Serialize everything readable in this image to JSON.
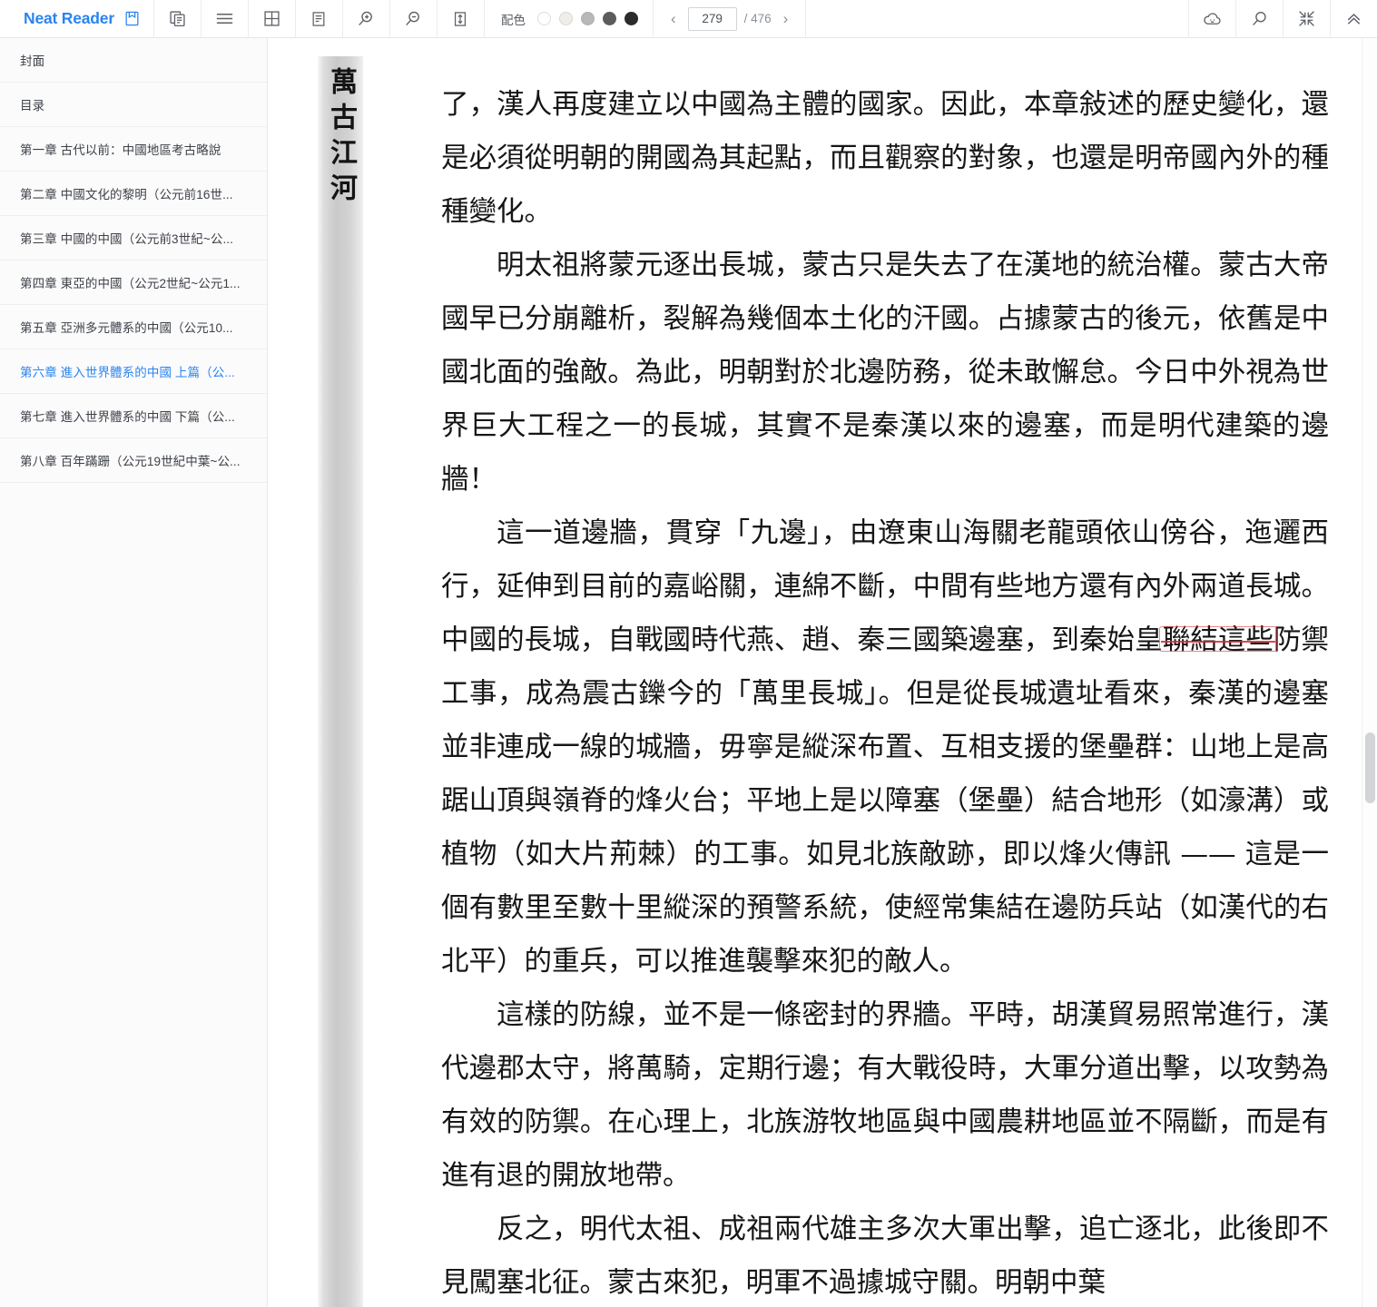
{
  "app": {
    "brand": "Neat Reader",
    "brand_accent": "#2a84f0"
  },
  "toolbar": {
    "icons": [
      {
        "name": "save-to-device-icon",
        "label": "保存"
      },
      {
        "name": "copy-pages-icon",
        "label": "双页"
      },
      {
        "name": "list-view-icon",
        "label": "列表"
      },
      {
        "name": "grid-view-icon",
        "label": "网格"
      },
      {
        "name": "single-page-icon",
        "label": "单页"
      },
      {
        "name": "zoom-in-icon",
        "label": "放大"
      },
      {
        "name": "zoom-out-icon",
        "label": "缩小"
      },
      {
        "name": "fit-height-icon",
        "label": "适应高度"
      }
    ],
    "color_theme": {
      "label": "配色",
      "swatches": [
        {
          "name": "theme-white",
          "color": "#ffffff",
          "border": "#dcdcdc"
        },
        {
          "name": "theme-paper",
          "color": "#f0eee9",
          "border": "#d9d7d1"
        },
        {
          "name": "theme-gray",
          "color": "#b8b8b8",
          "border": "#b0b0b0"
        },
        {
          "name": "theme-dark-gray",
          "color": "#5c5c5c",
          "border": "#5c5c5c"
        },
        {
          "name": "theme-black",
          "color": "#2b2b2b",
          "border": "#2b2b2b"
        }
      ],
      "selected_index": 0
    },
    "pager": {
      "prev": "‹",
      "next": "›",
      "current_page": "279",
      "total_label": "/ 476",
      "total_pages": 476
    },
    "right_icons": [
      {
        "name": "cloud-sync-icon",
        "label": "云同步"
      },
      {
        "name": "search-icon",
        "label": "搜索"
      },
      {
        "name": "exit-fullscreen-icon",
        "label": "退出全屏"
      },
      {
        "name": "collapse-toolbar-icon",
        "label": "收起工具栏"
      }
    ]
  },
  "sidebar": {
    "items": [
      {
        "label": "封面",
        "active": false
      },
      {
        "label": "目录",
        "active": false
      },
      {
        "label": "第一章 古代以前：中國地區考古略說",
        "active": false
      },
      {
        "label": "第二章 中國文化的黎明（公元前16世...",
        "active": false
      },
      {
        "label": "第三章 中國的中國（公元前3世紀~公...",
        "active": false
      },
      {
        "label": "第四章 東亞的中國（公元2世紀~公元1...",
        "active": false
      },
      {
        "label": "第五章 亞洲多元體系的中國（公元10...",
        "active": false
      },
      {
        "label": "第六章 進入世界體系的中國 上篇（公...",
        "active": true
      },
      {
        "label": "第七章 進入世界體系的中國 下篇（公...",
        "active": false
      },
      {
        "label": "第八章 百年蹣跚（公元19世紀中葉~公...",
        "active": false
      }
    ]
  },
  "reader": {
    "spine_title": "萬古江河",
    "paragraphs": [
      {
        "indent": false,
        "runs": [
          {
            "text": "了，漢人再度建立以中國為主體的國家。因此，本章敍述的歷史變化，還是必須從明朝的開國為其起點，而且觀察的對象，也還是明帝國內外的種種變化。",
            "marked": false
          }
        ]
      },
      {
        "indent": true,
        "runs": [
          {
            "text": "明太祖將蒙元逐出長城，蒙古只是失去了在漢地的統治權。蒙古大帝國早已分崩離析，裂解為幾個本土化的汗國。占據蒙古的後元，依舊是中國北面的強敵。為此，明朝對於北邊防務，從未敢懈怠。今日中外視為世界巨大工程之一的長城，其實不是秦漢以來的邊塞，而是明代建築的邊牆！",
            "marked": false
          }
        ]
      },
      {
        "indent": true,
        "runs": [
          {
            "text": "這一道邊牆，貫穿「九邊」，由遼東山海關老龍頭依山傍谷，迤邐西行，延伸到目前的嘉峪關，連綿不斷，中間有些地方還有內外兩道長城。中國的長城，自戰國時代燕、趙、秦三國築邊塞，到秦始皇",
            "marked": false
          },
          {
            "text": "聯結這些",
            "marked": true
          },
          {
            "text": "防禦工事，成為震古鑠今的「萬里長城」。但是從長城遺址看來，秦漢的邊塞並非連成一線的城牆，毋寧是縱深布置、互相支援的堡壘群：山地上是高踞山頂與嶺脊的烽火台；平地上是以障塞（堡壘）結合地形（如濠溝）或植物（如大片荊棘）的工事。如見北族敵跡，即以烽火傳訊 —— 這是一個有數里至數十里縱深的預警系統，使經常集結在邊防兵站（如漢代的右北平）的重兵，可以推進襲擊來犯的敵人。",
            "marked": false
          }
        ]
      },
      {
        "indent": true,
        "runs": [
          {
            "text": "這樣的防線，並不是一條密封的界牆。平時，胡漢貿易照常進行，漢代邊郡太守，將萬騎，定期行邊；有大戰役時，大軍分道出擊，以攻勢為有效的防禦。在心理上，北族游牧地區與中國農耕地區並不隔斷，而是有進有退的開放地帶。",
            "marked": false
          }
        ]
      },
      {
        "indent": true,
        "runs": [
          {
            "text": "反之，明代太祖、成祖兩代雄主多次大軍出擊，追亡逐北，此後即不見闖塞北征。蒙古來犯，明軍不過據城守關。明朝中葉",
            "marked": false
          }
        ]
      }
    ],
    "annotation_color": "#d6282f"
  }
}
